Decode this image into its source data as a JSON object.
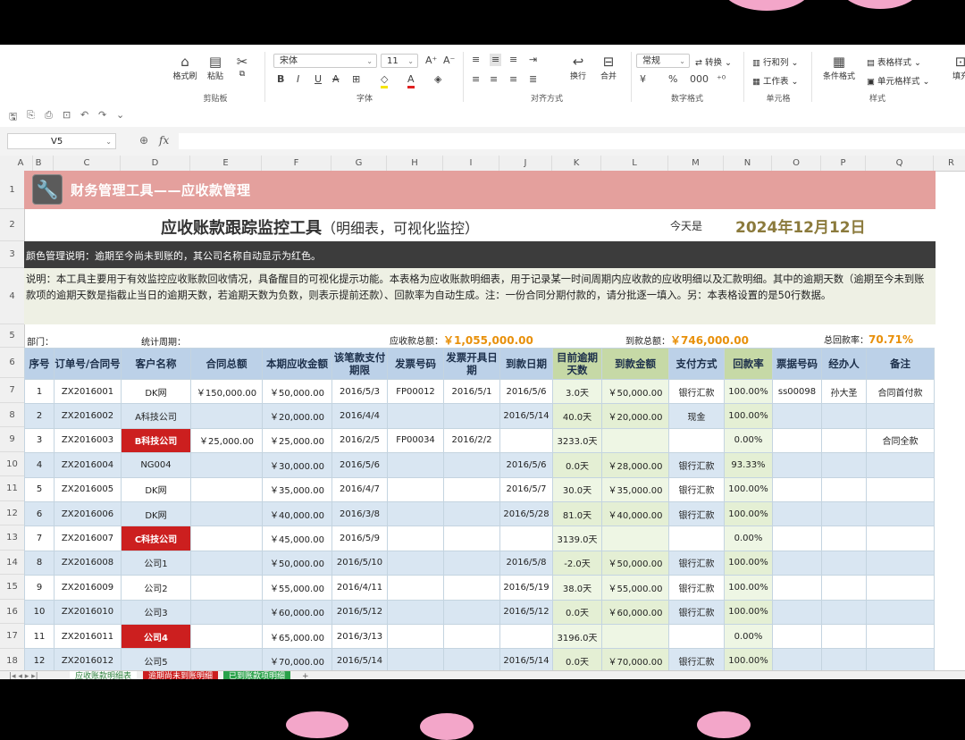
{
  "ribbon": {
    "clipboard": {
      "label": "剪贴板",
      "format_painter": "格式刷",
      "paste": "粘贴"
    },
    "font": {
      "label": "字体",
      "name": "宋体",
      "size": "11"
    },
    "alignment": {
      "label": "对齐方式",
      "wrap": "换行",
      "merge": "合并"
    },
    "number": {
      "label": "数字格式",
      "format": "常规",
      "convert": "转换"
    },
    "cells": {
      "label": "单元格",
      "row_col": "行和列",
      "worksheet": "工作表"
    },
    "styles": {
      "label": "样式",
      "cond_format": "条件格式",
      "table_style": "表格样式",
      "cell_style": "单元格样式",
      "fill": "填充"
    }
  },
  "formula_bar": {
    "cell_ref": "V5",
    "fx": "fx"
  },
  "columns": [
    "A",
    "B",
    "C",
    "D",
    "E",
    "F",
    "G",
    "H",
    "I",
    "J",
    "K",
    "L",
    "M",
    "N",
    "O",
    "P",
    "Q",
    "R"
  ],
  "rows": [
    "1",
    "2",
    "3",
    "4",
    "5",
    "6",
    "7",
    "8",
    "9",
    "10",
    "11",
    "12",
    "13",
    "14",
    "15",
    "16",
    "17",
    "18"
  ],
  "sheet": {
    "tool_title": "财务管理工具——应收款管理",
    "main_title": "应收账款跟踪监控工具",
    "main_subtitle": "（明细表，可视化监控）",
    "today_label": "今天是",
    "today_value": "2024年12月12日",
    "color_note": "颜色管理说明：逾期至今尚未到账的，其公司名称自动显示为红色。",
    "description": "说明：本工具主要用于有效监控应收账款回收情况，具备醒目的可视化提示功能。本表格为应收账款明细表，用于记录某一时间周期内应收款的应收明细以及汇款明细。其中的逾期天数（逾期至今未到账款项的逾期天数是指截止当日的逾期天数，若逾期天数为负数，则表示提前还款）、回款率为自动生成。注：一份合同分期付款的，请分批逐一填入。另：本表格设置的是50行数据。",
    "dept_label": "部门：",
    "period_label": "统计周期：",
    "receivable_total_label": "应收款总额：",
    "receivable_total": "￥1,055,000.00",
    "received_total_label": "到款总额：",
    "received_total": "￥746,000.00",
    "return_rate_label": "总回款率：",
    "return_rate": "70.71%"
  },
  "table": {
    "headers": [
      "序号",
      "订单号/合同号",
      "客户名称",
      "合同总额",
      "本期应收金额",
      "该笔款支付期限",
      "发票号码",
      "发票开具日期",
      "到款日期",
      "目前逾期天数",
      "到款金额",
      "支付方式",
      "回款率",
      "票据号码",
      "经办人",
      "备注"
    ],
    "rows": [
      [
        "1",
        "ZX2016001",
        "DK网",
        "￥150,000.00",
        "￥50,000.00",
        "2016/5/3",
        "FP00012",
        "2016/5/1",
        "2016/5/6",
        "3.0天",
        "￥50,000.00",
        "银行汇款",
        "100.00%",
        "ss00098",
        "孙大圣",
        "合同首付款"
      ],
      [
        "2",
        "ZX2016002",
        "A科技公司",
        "",
        "￥20,000.00",
        "2016/4/4",
        "",
        "",
        "2016/5/14",
        "40.0天",
        "￥20,000.00",
        "现金",
        "100.00%",
        "",
        "",
        ""
      ],
      [
        "3",
        "ZX2016003",
        "B科技公司",
        "￥25,000.00",
        "￥25,000.00",
        "2016/2/5",
        "FP00034",
        "2016/2/2",
        "",
        "3233.0天",
        "",
        "",
        "0.00%",
        "",
        "",
        "合同全款"
      ],
      [
        "4",
        "ZX2016004",
        "NG004",
        "",
        "￥30,000.00",
        "2016/5/6",
        "",
        "",
        "2016/5/6",
        "0.0天",
        "￥28,000.00",
        "银行汇款",
        "93.33%",
        "",
        "",
        ""
      ],
      [
        "5",
        "ZX2016005",
        "DK网",
        "",
        "￥35,000.00",
        "2016/4/7",
        "",
        "",
        "2016/5/7",
        "30.0天",
        "￥35,000.00",
        "银行汇款",
        "100.00%",
        "",
        "",
        ""
      ],
      [
        "6",
        "ZX2016006",
        "DK网",
        "",
        "￥40,000.00",
        "2016/3/8",
        "",
        "",
        "2016/5/28",
        "81.0天",
        "￥40,000.00",
        "银行汇款",
        "100.00%",
        "",
        "",
        ""
      ],
      [
        "7",
        "ZX2016007",
        "C科技公司",
        "",
        "￥45,000.00",
        "2016/5/9",
        "",
        "",
        "",
        "3139.0天",
        "",
        "",
        "0.00%",
        "",
        "",
        ""
      ],
      [
        "8",
        "ZX2016008",
        "公司1",
        "",
        "￥50,000.00",
        "2016/5/10",
        "",
        "",
        "2016/5/8",
        "-2.0天",
        "￥50,000.00",
        "银行汇款",
        "100.00%",
        "",
        "",
        ""
      ],
      [
        "9",
        "ZX2016009",
        "公司2",
        "",
        "￥55,000.00",
        "2016/4/11",
        "",
        "",
        "2016/5/19",
        "38.0天",
        "￥55,000.00",
        "银行汇款",
        "100.00%",
        "",
        "",
        ""
      ],
      [
        "10",
        "ZX2016010",
        "公司3",
        "",
        "￥60,000.00",
        "2016/5/12",
        "",
        "",
        "2016/5/12",
        "0.0天",
        "￥60,000.00",
        "银行汇款",
        "100.00%",
        "",
        "",
        ""
      ],
      [
        "11",
        "ZX2016011",
        "公司4",
        "",
        "￥65,000.00",
        "2016/3/13",
        "",
        "",
        "",
        "3196.0天",
        "",
        "",
        "0.00%",
        "",
        "",
        ""
      ],
      [
        "12",
        "ZX2016012",
        "公司5",
        "",
        "￥70,000.00",
        "2016/5/14",
        "",
        "",
        "2016/5/14",
        "0.0天",
        "￥70,000.00",
        "银行汇款",
        "100.00%",
        "",
        "",
        ""
      ]
    ],
    "overdue_rows": [
      2,
      6,
      10
    ]
  },
  "tabs": [
    "应收账款明细表",
    "逾期尚未到账明细",
    "已到账款项明细"
  ],
  "colors": {
    "title_bar": "#e4a09d",
    "header_blue": "#bcd1e8",
    "header_green": "#c6d9a6",
    "overdue_red": "#cc1f1f",
    "date_gold": "#8b7a3c",
    "total_orange": "#e8900a"
  }
}
